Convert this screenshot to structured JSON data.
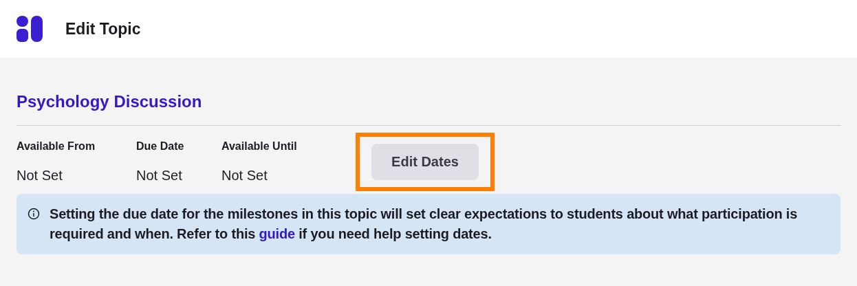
{
  "header": {
    "title": "Edit Topic"
  },
  "topic": {
    "title": "Psychology Discussion"
  },
  "dates": [
    {
      "label": "Available From",
      "value": "Not Set"
    },
    {
      "label": "Due Date",
      "value": "Not Set"
    },
    {
      "label": "Available Until",
      "value": "Not Set"
    }
  ],
  "edit_button": {
    "label": "Edit Dates",
    "highlighted": true
  },
  "info": {
    "text_before": "Setting the due date for the milestones in this topic will set clear expectations to students about what participation is required and when. Refer to this",
    "link": "guide",
    "text_after": "if you need help setting dates."
  }
}
